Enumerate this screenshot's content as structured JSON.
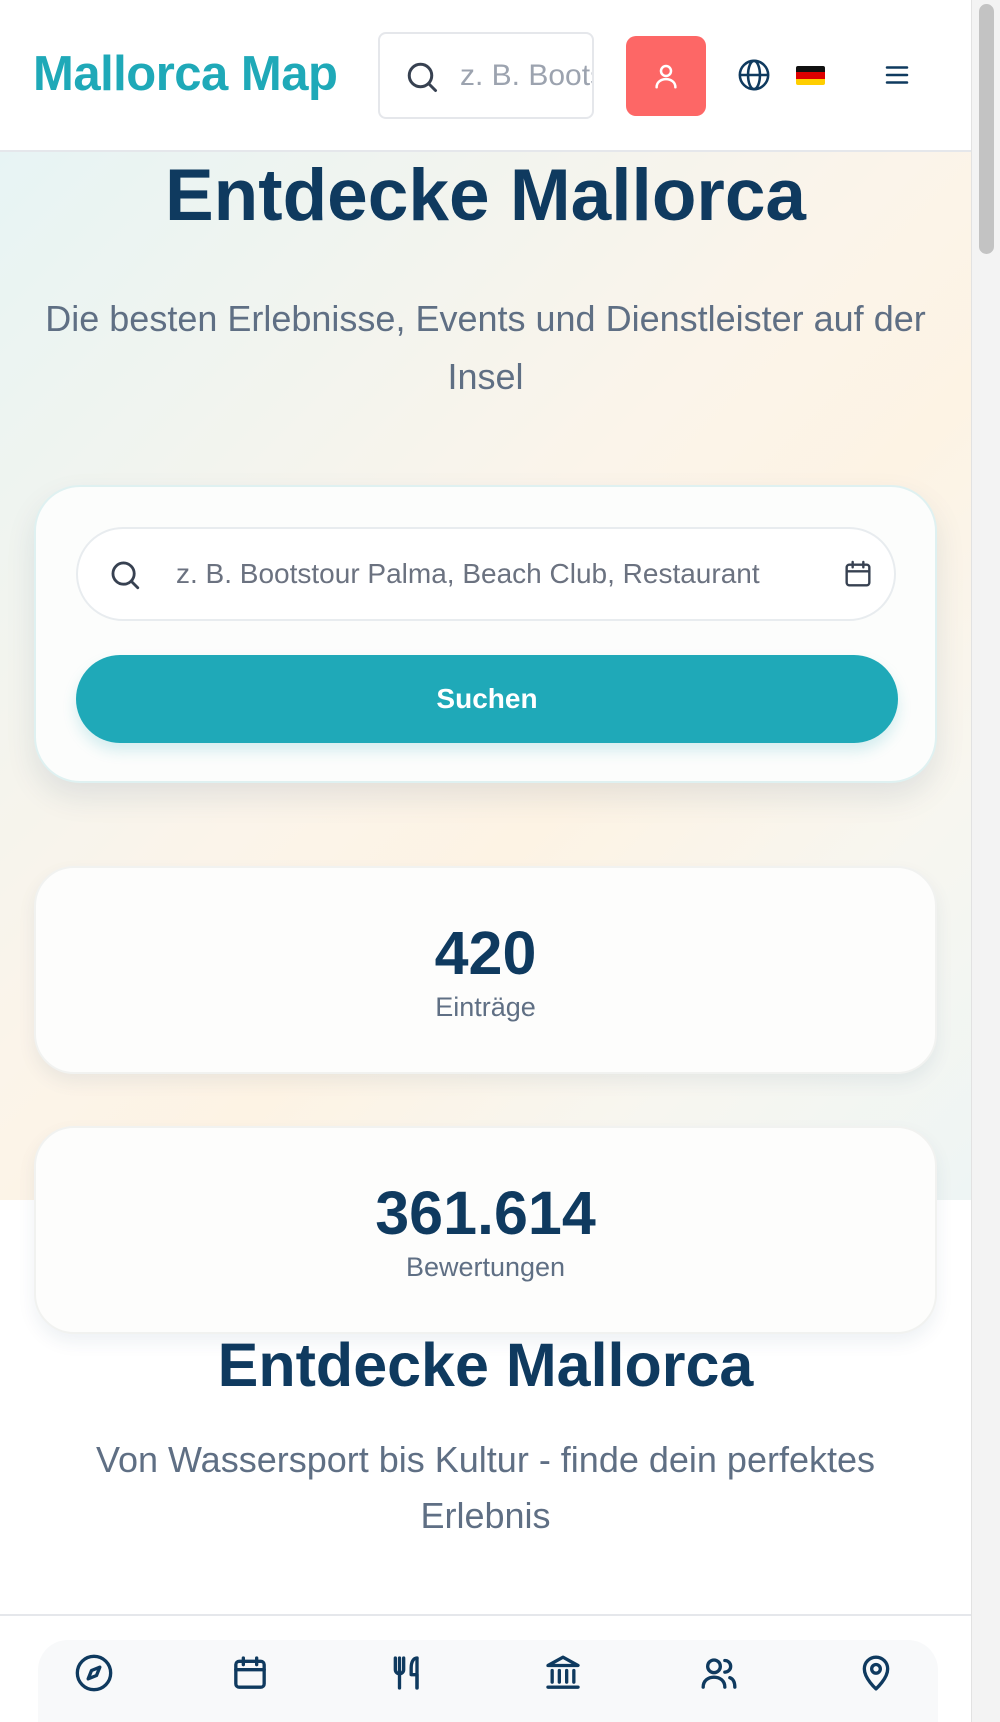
{
  "header": {
    "logo": "Mallorca Map",
    "search_placeholder": "z. B. Bootstour Palma, Beach Club, Restaurant",
    "icons": [
      "search-icon",
      "user-icon",
      "globe-icon",
      "flag-de-icon",
      "menu-icon"
    ]
  },
  "hero": {
    "title": "Entdecke Mallorca",
    "subtitle": "Die besten Erlebnisse, Events und Dienstleister auf der Insel",
    "search_placeholder": "z. B. Bootstour Palma, Beach Club, Restaurant",
    "search_button": "Suchen"
  },
  "stats": [
    {
      "value": "420",
      "label": "Einträge"
    },
    {
      "value": "361.614",
      "label": "Bewertungen"
    }
  ],
  "section": {
    "title": "Entdecke Mallorca",
    "subtitle": "Von Wassersport bis Kultur - finde dein perfektes Erlebnis"
  },
  "bottom_nav": {
    "items": [
      "compass-icon",
      "calendar-icon",
      "utensils-icon",
      "museum-icon",
      "users-icon",
      "map-pin-icon"
    ]
  },
  "colors": {
    "brand": "#1fa9b8",
    "navy": "#0f3a5f",
    "coral": "#fd6766",
    "muted": "#5f6f84"
  }
}
